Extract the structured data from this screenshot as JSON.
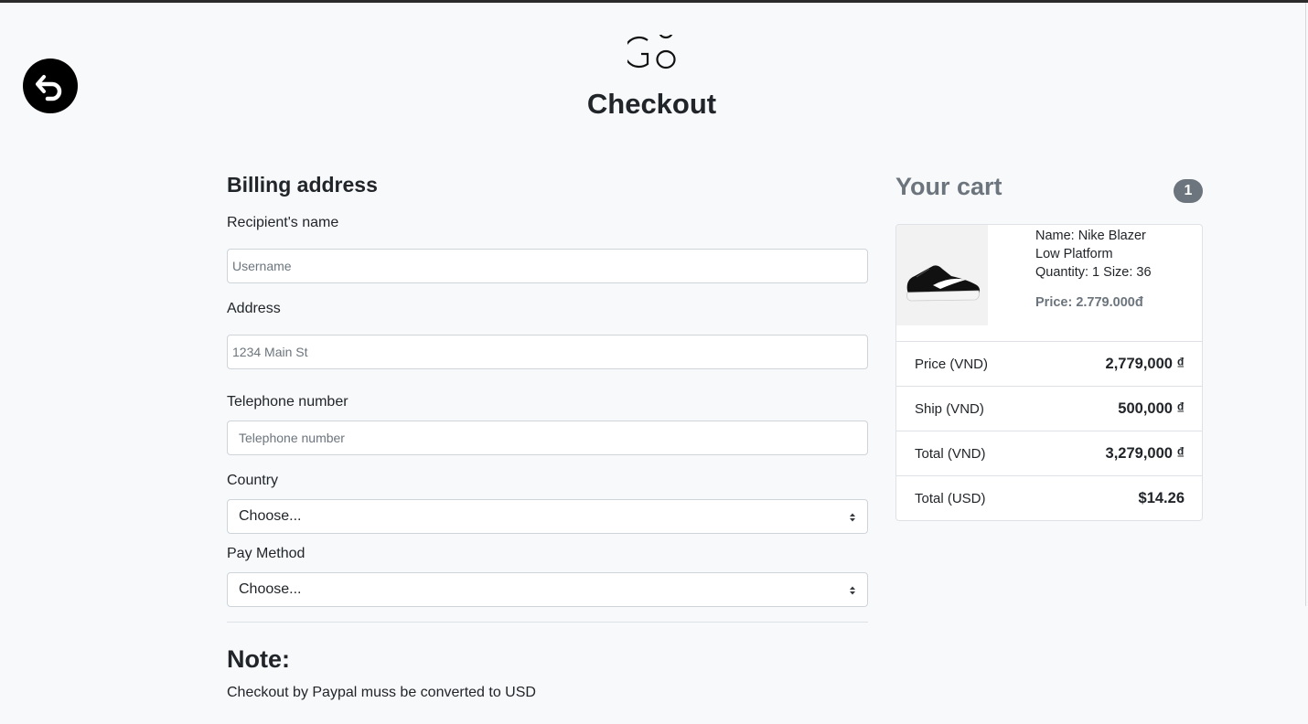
{
  "header": {
    "logo_text": "G8",
    "title": "Checkout",
    "back_icon": "undo-icon"
  },
  "billing": {
    "title": "Billing address",
    "name_label": "Recipient's name",
    "name_placeholder": "Username",
    "name_value": "",
    "address_label": "Address",
    "address_placeholder": "1234 Main St",
    "address_value": "",
    "phone_label": "Telephone number",
    "phone_placeholder": "Telephone number",
    "phone_value": "",
    "country_label": "Country",
    "country_selected": "Choose...",
    "pay_label": "Pay Method",
    "pay_selected": "Choose..."
  },
  "note": {
    "title": "Note:",
    "text": "Checkout by Paypal muss be converted to USD"
  },
  "cart": {
    "title": "Your cart",
    "count": "1",
    "item": {
      "name_line1": "Name: Nike Blazer",
      "name_line2": "Low Platform",
      "qty_size": "Quantity: 1 Size: 36",
      "price": "Price: 2.779.000đ"
    },
    "summary": [
      {
        "label": "Price (VND)",
        "value": "2,779,000 ₫"
      },
      {
        "label": "Ship (VND)",
        "value": "500,000 ₫"
      },
      {
        "label": "Total (VND)",
        "value": "3,279,000 ₫"
      },
      {
        "label": "Total (USD)",
        "value": "$14.26"
      }
    ]
  },
  "colors": {
    "background": "#f8f9fa",
    "muted": "#6c757d",
    "text": "#212529"
  }
}
